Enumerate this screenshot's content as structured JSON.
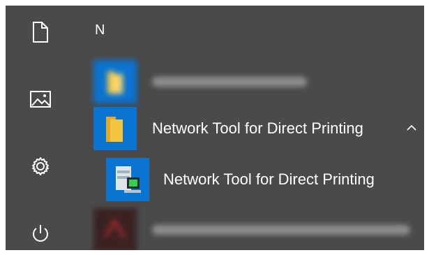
{
  "rail": {
    "items": [
      {
        "name": "documents",
        "icon": "document-icon"
      },
      {
        "name": "pictures",
        "icon": "picture-icon"
      },
      {
        "name": "settings",
        "icon": "gear-icon"
      },
      {
        "name": "power",
        "icon": "power-icon"
      }
    ]
  },
  "app_list": {
    "group_letter": "N",
    "items": [
      {
        "label": "",
        "icon": "folder-icon",
        "blurred": true
      },
      {
        "label": "Network Tool for Direct Printing",
        "icon": "folder-icon",
        "expanded": true,
        "chevron": "chevron-up-icon"
      },
      {
        "label": "Network Tool for Direct Printing",
        "icon": "printer-app-icon",
        "indented": true
      },
      {
        "label": "",
        "icon": "app-icon",
        "blurred": true
      }
    ]
  },
  "colors": {
    "background": "#4a4a4a",
    "tile_blue": "#0a74d1",
    "folder_yellow": "#f3c440",
    "text": "#ffffff"
  }
}
